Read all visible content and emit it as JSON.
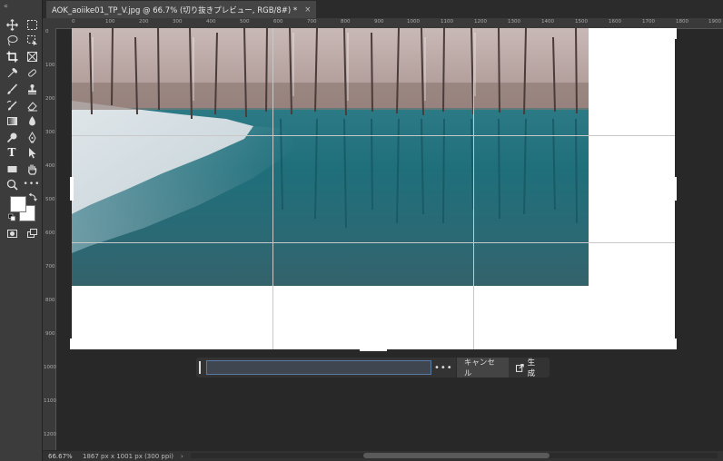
{
  "toolbar": {
    "collapse_icon": "double-chevron-icon",
    "tools": [
      "move-tool-icon",
      "marquee-tool-icon",
      "lasso-tool-icon",
      "object-select-tool-icon",
      "crop-tool-icon",
      "frame-tool-icon",
      "eyedropper-tool-icon",
      "healing-brush-icon",
      "brush-tool-icon",
      "stamp-tool-icon",
      "history-brush-icon",
      "eraser-tool-icon",
      "gradient-tool-icon",
      "blur-tool-icon",
      "dodge-tool-icon",
      "pen-tool-icon",
      "type-tool-icon",
      "path-select-tool-icon",
      "rectangle-tool-icon",
      "hand-tool-icon",
      "zoom-tool-icon",
      "more-tools-icon",
      "quick-mask-icon",
      "screen-mode-icon"
    ],
    "foreground_color": "#ffffff",
    "background_color": "#ffffff"
  },
  "tab": {
    "title": "AOK_aoiike01_TP_V.jpg @ 66.7% (切り抜きプレビュー, RGB/8#) *",
    "close": "×"
  },
  "ruler_top": {
    "labels": [
      "0",
      "100",
      "200",
      "300",
      "400",
      "500",
      "600",
      "700",
      "800",
      "900",
      "1000",
      "1100",
      "1200",
      "1300",
      "1400",
      "1500",
      "1600",
      "1700",
      "1800",
      "1900"
    ]
  },
  "ruler_left": {
    "labels": [
      "0",
      "100",
      "200",
      "300",
      "400",
      "500",
      "600",
      "700",
      "800",
      "900",
      "1000",
      "1100",
      "1200"
    ]
  },
  "gen_bar": {
    "prompt_placeholder": "",
    "more": "•••",
    "cancel_label": "キャンセル",
    "generate_label": "生成",
    "generate_icon": "external-generate-icon"
  },
  "status": {
    "zoom": "66.67%",
    "dimensions": "1867 px x 1001 px (300 ppi)",
    "arrow": "›"
  },
  "colors": {
    "panel": "#3c3c3c",
    "workspace": "#282828",
    "accent": "#5a7aa6"
  }
}
